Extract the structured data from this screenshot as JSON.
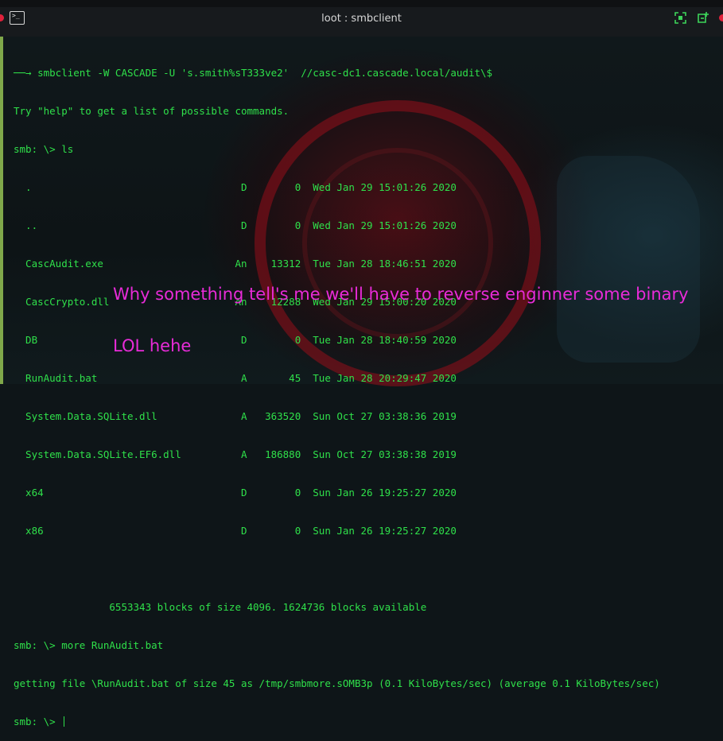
{
  "window": {
    "title": "loot : smbclient"
  },
  "terminal": {
    "lines": [
      "──→ smbclient -W CASCADE -U 's.smith%sT333ve2'  //casc-dc1.cascade.local/audit\\$",
      "Try \"help\" to get a list of possible commands.",
      "smb: \\> ls",
      "  .                                   D        0  Wed Jan 29 15:01:26 2020",
      "  ..                                  D        0  Wed Jan 29 15:01:26 2020",
      "  CascAudit.exe                      An    13312  Tue Jan 28 18:46:51 2020",
      "  CascCrypto.dll                     An    12288  Wed Jan 29 15:00:20 2020",
      "  DB                                  D        0  Tue Jan 28 18:40:59 2020",
      "  RunAudit.bat                        A       45  Tue Jan 28 20:29:47 2020",
      "  System.Data.SQLite.dll              A   363520  Sun Oct 27 03:38:36 2019",
      "  System.Data.SQLite.EF6.dll          A   186880  Sun Oct 27 03:38:38 2019",
      "  x64                                 D        0  Sun Jan 26 19:25:27 2020",
      "  x86                                 D        0  Sun Jan 26 19:25:27 2020",
      "",
      "                6553343 blocks of size 4096. 1624736 blocks available",
      "smb: \\> more RunAudit.bat",
      "getting file \\RunAudit.bat of size 45 as /tmp/smbmore.sOMB3p (0.1 KiloBytes/sec) (average 0.1 KiloBytes/sec)",
      "smb: \\> "
    ]
  },
  "annotations": {
    "line1": "Why something tell's me we'll have to reverse enginner some binary",
    "line2": "LOL hehe"
  },
  "colors": {
    "terminal_text": "#2fe04a",
    "annotation": "#e82bd8",
    "close_dot": "#e0213b"
  },
  "icons": {
    "app": "terminal-icon",
    "maximize": "maximize-icon",
    "new_tab": "new-tab-icon"
  }
}
